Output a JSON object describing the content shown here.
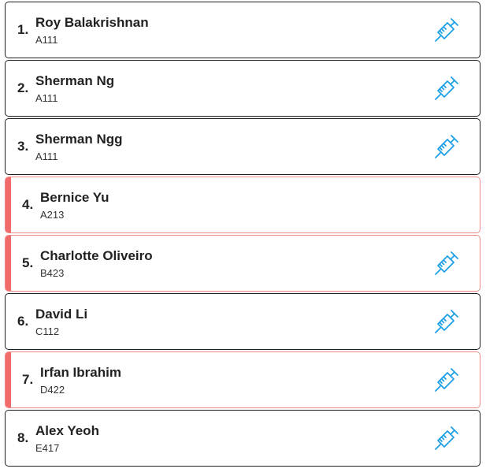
{
  "patients": [
    {
      "number": "1.",
      "name": "Roy Balakrishnan",
      "code": "A111",
      "flagged": false,
      "vaccine_icon": "syringe-icon",
      "has_vaccine_icon": true
    },
    {
      "number": "2.",
      "name": "Sherman Ng",
      "code": "A111",
      "flagged": false,
      "vaccine_icon": "syringe-icon",
      "has_vaccine_icon": true
    },
    {
      "number": "3.",
      "name": "Sherman Ngg",
      "code": "A111",
      "flagged": false,
      "vaccine_icon": "syringe-icon",
      "has_vaccine_icon": true
    },
    {
      "number": "4.",
      "name": "Bernice Yu",
      "code": "A213",
      "flagged": true,
      "vaccine_icon": "syringe-icon",
      "has_vaccine_icon": false
    },
    {
      "number": "5.",
      "name": "Charlotte Oliveiro",
      "code": "B423",
      "flagged": true,
      "vaccine_icon": "syringe-icon",
      "has_vaccine_icon": true
    },
    {
      "number": "6.",
      "name": "David Li",
      "code": "C112",
      "flagged": false,
      "vaccine_icon": "syringe-icon",
      "has_vaccine_icon": true
    },
    {
      "number": "7.",
      "name": "Irfan Ibrahim",
      "code": "D422",
      "flagged": true,
      "vaccine_icon": "syringe-icon",
      "has_vaccine_icon": true
    },
    {
      "number": "8.",
      "name": "Alex Yeoh",
      "code": "E417",
      "flagged": false,
      "vaccine_icon": "syringe-icon",
      "has_vaccine_icon": true
    }
  ],
  "colors": {
    "flag": "#f26b6b",
    "flag_border": "#f08a8a",
    "icon": "#1ea0e6",
    "border": "#1f1f1f"
  }
}
